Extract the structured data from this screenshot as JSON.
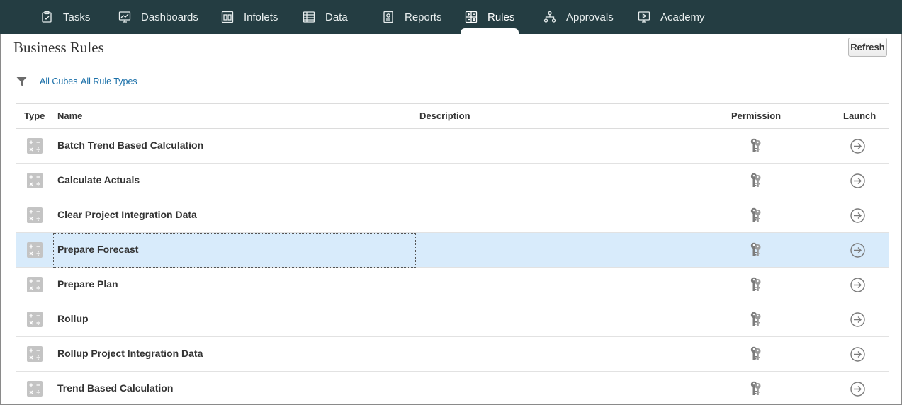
{
  "nav": {
    "items": [
      {
        "label": "Tasks",
        "icon": "clipboard-icon"
      },
      {
        "label": "Dashboards",
        "icon": "monitor-chart-icon"
      },
      {
        "label": "Infolets",
        "icon": "infolet-icon"
      },
      {
        "label": "Data",
        "icon": "grid-icon"
      },
      {
        "label": "Reports",
        "icon": "report-icon"
      },
      {
        "label": "Rules",
        "icon": "rules-icon"
      },
      {
        "label": "Approvals",
        "icon": "hierarchy-icon"
      },
      {
        "label": "Academy",
        "icon": "play-screen-icon"
      }
    ],
    "active": "Rules"
  },
  "page": {
    "title": "Business Rules",
    "refresh_label": "Refresh"
  },
  "filters": {
    "cubes": "All Cubes",
    "rule_types": "All Rule Types"
  },
  "table": {
    "columns": {
      "type": "Type",
      "name": "Name",
      "description": "Description",
      "permission": "Permission",
      "launch": "Launch"
    },
    "rows": [
      {
        "name": "Batch Trend Based Calculation",
        "description": ""
      },
      {
        "name": "Calculate Actuals",
        "description": ""
      },
      {
        "name": "Clear Project Integration Data",
        "description": ""
      },
      {
        "name": "Prepare Forecast",
        "description": "",
        "selected": true
      },
      {
        "name": "Prepare Plan",
        "description": ""
      },
      {
        "name": "Rollup",
        "description": ""
      },
      {
        "name": "Rollup Project Integration Data",
        "description": ""
      },
      {
        "name": "Trend Based Calculation",
        "description": ""
      }
    ]
  },
  "colors": {
    "nav_bg": "#243d42",
    "link": "#1a6fa8",
    "selected_row": "#d8ebfb"
  }
}
